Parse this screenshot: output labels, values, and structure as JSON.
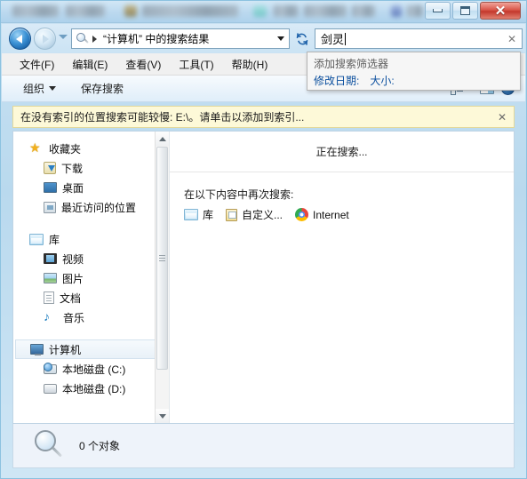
{
  "window": {
    "titlebar_blurred": true,
    "controls": {
      "minimize": "—",
      "maximize": "□",
      "close": "✕"
    }
  },
  "navigation": {
    "back_label": "后退",
    "forward_label": "前进",
    "recent_pages_label": "最近浏览的页面",
    "address_value": "“计算机” 中的搜索结果",
    "refresh_label": "刷新",
    "search_icon": "search-icon"
  },
  "search": {
    "value": "剑灵",
    "clear_label": "✕",
    "dropdown": {
      "title": "添加搜索筛选器",
      "filters": [
        {
          "label": "修改日期:"
        },
        {
          "label": "大小:"
        }
      ]
    }
  },
  "menubar": {
    "items": [
      {
        "label": "文件(F)"
      },
      {
        "label": "编辑(E)"
      },
      {
        "label": "查看(V)"
      },
      {
        "label": "工具(T)"
      },
      {
        "label": "帮助(H)"
      }
    ]
  },
  "commandbar": {
    "organize": "组织",
    "save_search": "保存搜索",
    "view_label": "更改您的视图",
    "preview_label": "显示预览窗格",
    "help_label": "?"
  },
  "notification": {
    "text": "在没有索引的位置搜索可能较慢: E:\\。请单击以添加到索引...",
    "close_label": "✕",
    "background": "#fdf9d8"
  },
  "sidebar": {
    "groups": [
      {
        "header": {
          "label": "收藏夹",
          "icon": "star-icon"
        },
        "items": [
          {
            "label": "下载",
            "icon": "download-icon"
          },
          {
            "label": "桌面",
            "icon": "desktop-icon"
          },
          {
            "label": "最近访问的位置",
            "icon": "recent-places-icon"
          }
        ]
      },
      {
        "header": {
          "label": "库",
          "icon": "library-folder-icon"
        },
        "items": [
          {
            "label": "视频",
            "icon": "video-icon"
          },
          {
            "label": "图片",
            "icon": "picture-icon"
          },
          {
            "label": "文档",
            "icon": "document-icon"
          },
          {
            "label": "音乐",
            "icon": "music-icon"
          }
        ]
      },
      {
        "header": {
          "label": "计算机",
          "icon": "computer-icon",
          "selected": true
        },
        "items": [
          {
            "label": "本地磁盘 (C:)",
            "icon": "system-drive-icon"
          },
          {
            "label": "本地磁盘 (D:)",
            "icon": "drive-icon"
          }
        ]
      }
    ]
  },
  "content": {
    "searching_text": "正在搜索...",
    "again_label": "在以下内容中再次搜索:",
    "again_items": [
      {
        "label": "库",
        "icon": "library-folder-icon"
      },
      {
        "label": "自定义...",
        "icon": "custom-search-icon"
      },
      {
        "label": "Internet",
        "icon": "chrome-icon"
      }
    ]
  },
  "statusbar": {
    "icon": "magnifier-icon",
    "text": "0 个对象"
  }
}
